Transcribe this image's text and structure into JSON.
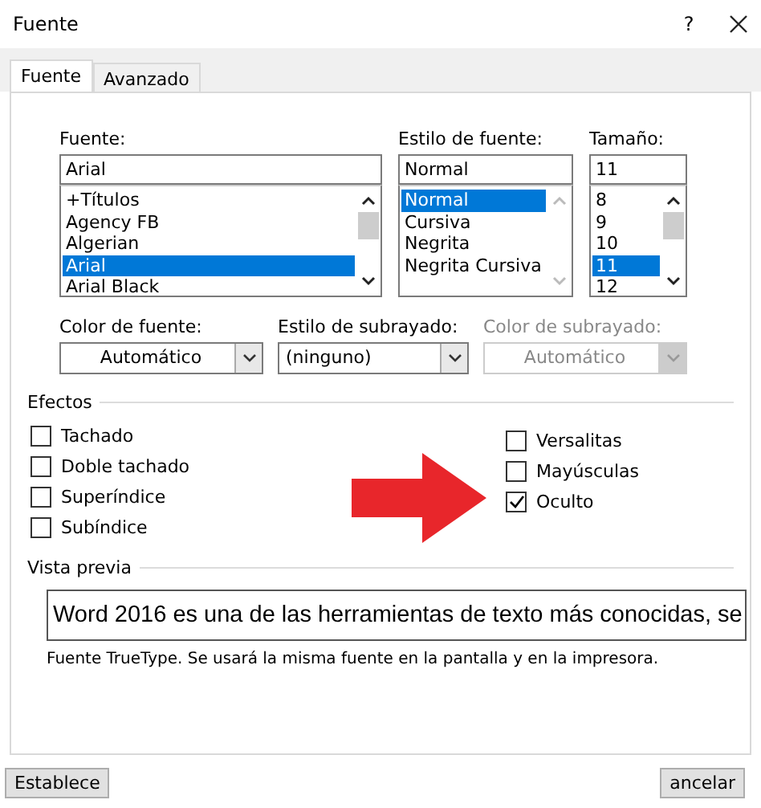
{
  "window": {
    "title": "Fuente",
    "help": "?"
  },
  "tabs": [
    {
      "label": "Fuente",
      "selected": true
    },
    {
      "label": "Avanzado",
      "selected": false
    }
  ],
  "lists": [
    {
      "label": "Fuente:",
      "value": "Arial",
      "scroll_enabled": true,
      "items": [
        {
          "text": "+Títulos",
          "selected": false
        },
        {
          "text": "Agency FB",
          "selected": false
        },
        {
          "text": "Algerian",
          "selected": false
        },
        {
          "text": "Arial",
          "selected": true
        },
        {
          "text": "Arial Black",
          "selected": false
        }
      ]
    },
    {
      "label": "Estilo de fuente:",
      "value": "Normal",
      "scroll_enabled": false,
      "items": [
        {
          "text": "Normal",
          "selected": true
        },
        {
          "text": "Cursiva",
          "selected": false
        },
        {
          "text": "Negrita",
          "selected": false
        },
        {
          "text": "Negrita Cursiva",
          "selected": false
        }
      ]
    },
    {
      "label": "Tamaño:",
      "value": "11",
      "scroll_enabled": true,
      "items": [
        {
          "text": "8",
          "selected": false
        },
        {
          "text": "9",
          "selected": false
        },
        {
          "text": "10",
          "selected": false
        },
        {
          "text": "11",
          "selected": true
        },
        {
          "text": "12",
          "selected": false
        }
      ]
    }
  ],
  "dropdowns": [
    {
      "label": "Color de fuente:",
      "value": "Automático",
      "kind": "color",
      "disabled": false
    },
    {
      "label": "Estilo de subrayado:",
      "value": "(ninguno)",
      "kind": "style",
      "disabled": false
    },
    {
      "label": "Color de subrayado:",
      "value": "Automático",
      "kind": "color",
      "disabled": true
    }
  ],
  "effects": {
    "title": "Efectos",
    "left": [
      {
        "label": "Tachado",
        "checked": false
      },
      {
        "label": "Doble tachado",
        "checked": false
      },
      {
        "label": "Superíndice",
        "checked": false
      },
      {
        "label": "Subíndice",
        "checked": false
      }
    ],
    "right": [
      {
        "label": "Versalitas",
        "checked": false
      },
      {
        "label": "Mayúsculas",
        "checked": false
      },
      {
        "label": "Oculto",
        "checked": true
      }
    ]
  },
  "preview": {
    "title": "Vista previa",
    "sample": "Word 2016 es una de las herramientas de texto más conocidas, se",
    "note": "Fuente TrueType. Se usará la misma fuente en la pantalla y en la impresora."
  },
  "buttons": [
    {
      "label": "Establece"
    },
    {
      "label": "ancelar"
    }
  ]
}
